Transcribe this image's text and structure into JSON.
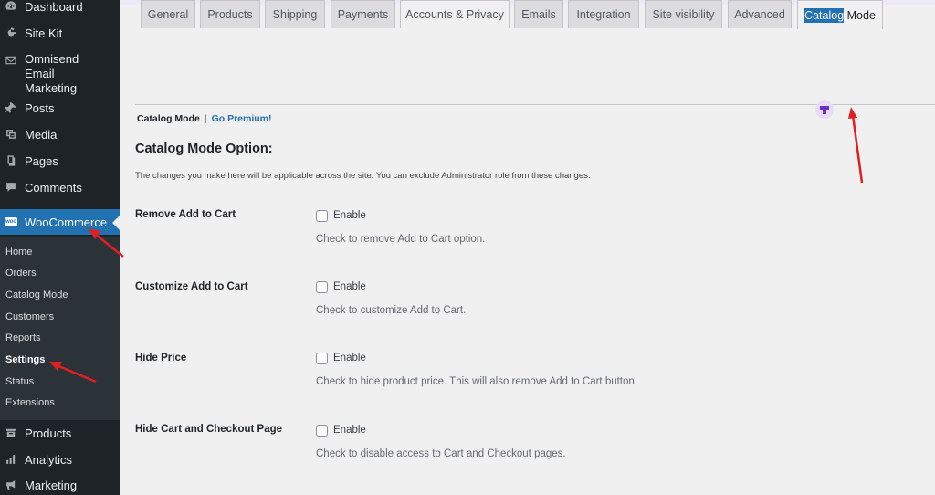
{
  "sidebar": {
    "items": [
      {
        "label": "Dashboard",
        "icon": "dashboard-icon"
      },
      {
        "label": "Site Kit",
        "icon": "google-g-icon"
      },
      {
        "label": "Omnisend Email Marketing",
        "icon": "email-icon"
      },
      {
        "label": "Posts",
        "icon": "pin-icon"
      },
      {
        "label": "Media",
        "icon": "media-icon"
      },
      {
        "label": "Pages",
        "icon": "pages-icon"
      },
      {
        "label": "Comments",
        "icon": "comment-icon"
      },
      {
        "label": "WooCommerce",
        "icon": "woo-icon"
      }
    ],
    "woo_logo_text": "woo",
    "submenu": [
      "Home",
      "Orders",
      "Catalog Mode",
      "Customers",
      "Reports",
      "Settings",
      "Status",
      "Extensions"
    ],
    "current_submenu": "Settings",
    "bottom_items": [
      {
        "label": "Products",
        "icon": "products-icon"
      },
      {
        "label": "Analytics",
        "icon": "analytics-icon"
      },
      {
        "label": "Marketing",
        "icon": "megaphone-icon"
      }
    ]
  },
  "tabs": [
    "General",
    "Products",
    "Shipping",
    "Payments",
    "Accounts & Privacy",
    "Emails",
    "Integration",
    "Site visibility",
    "Advanced"
  ],
  "active_tab": {
    "highlighted": "Catalog",
    "rest": " Mode"
  },
  "subnav": {
    "current": "Catalog Mode",
    "separator": "|",
    "link": "Go Premium!"
  },
  "page": {
    "title": "Catalog Mode Option:",
    "description": "The changes you make here will be applicable across the site. You can exclude Administrator role from these changes."
  },
  "options": [
    {
      "label": "Remove Add to Cart",
      "enable": "Enable",
      "desc": "Check to remove Add to Cart option.",
      "checked": false
    },
    {
      "label": "Customize Add to Cart",
      "enable": "Enable",
      "desc": "Check to customize Add to Cart.",
      "checked": false
    },
    {
      "label": "Hide Price",
      "enable": "Enable",
      "desc": "Check to hide product price. This will also remove Add to Cart button.",
      "checked": false
    },
    {
      "label": "Hide Cart and Checkout Page",
      "enable": "Enable",
      "desc": "Check to disable access to Cart and Checkout pages.",
      "checked": false
    }
  ],
  "colors": {
    "admin_blue": "#2271b1",
    "sidebar_bg": "#1d2327",
    "arrow_red": "#e02020"
  }
}
